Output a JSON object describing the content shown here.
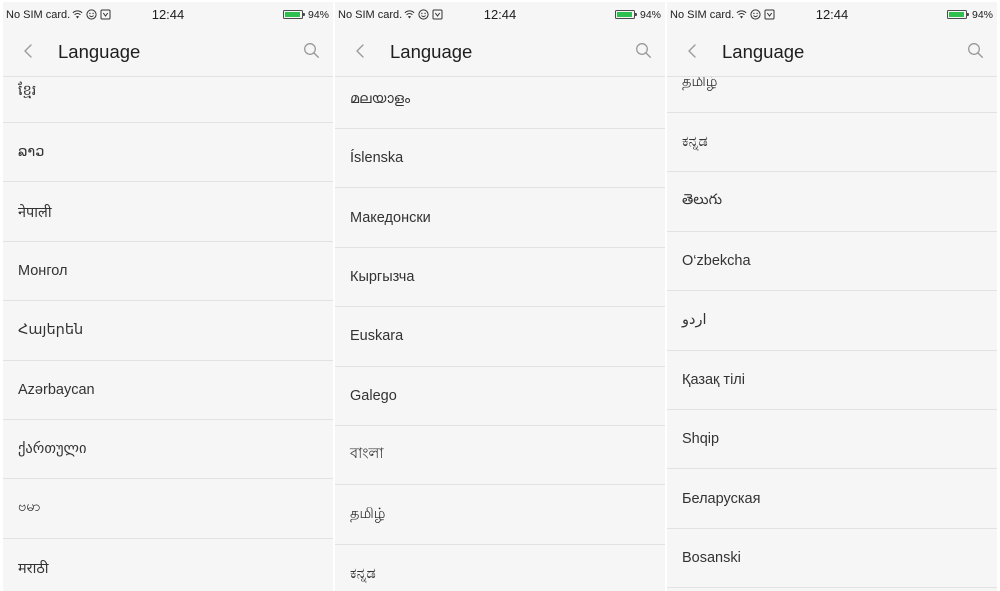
{
  "colors": {
    "page_background": "#ffffff",
    "panel_background": "#f6f6f6",
    "separator": "#e2e2e2",
    "text": "#1e1e1e",
    "list_text": "#333333",
    "icon_gray": "#9a9a9a",
    "battery_green": "#2fbf4f"
  },
  "panels": [
    {
      "status_bar": {
        "carrier": "No SIM card.",
        "icons": [
          "wifi-icon",
          "smiley-icon",
          "notification-icon"
        ],
        "time": "12:44",
        "battery_icon": "battery-icon",
        "battery_level": 0.94,
        "battery_text": "94%"
      },
      "header": {
        "back_icon": "chevron-left-icon",
        "title": "Language",
        "search_icon": "search-icon"
      },
      "languages": [
        "ខ្មែរ",
        "ລາວ",
        "नेपाली",
        "Монгол",
        "Հայերեն",
        "Azərbaycan",
        "ქართული",
        "ဗမာ",
        "मराठी"
      ]
    },
    {
      "status_bar": {
        "carrier": "No SIM card.",
        "icons": [
          "wifi-icon",
          "smiley-icon",
          "notification-icon"
        ],
        "time": "12:44",
        "battery_icon": "battery-icon",
        "battery_level": 0.94,
        "battery_text": "94%"
      },
      "header": {
        "back_icon": "chevron-left-icon",
        "title": "Language",
        "search_icon": "search-icon"
      },
      "languages": [
        "മലയാളം",
        "Íslenska",
        "Македонски",
        "Кыргызча",
        "Euskara",
        "Galego",
        "বাংলা",
        "தமிழ்",
        "ಕನ್ನಡ"
      ]
    },
    {
      "status_bar": {
        "carrier": "No SIM card.",
        "icons": [
          "wifi-icon",
          "smiley-icon",
          "notification-icon"
        ],
        "time": "12:44",
        "battery_icon": "battery-icon",
        "battery_level": 0.94,
        "battery_text": "94%"
      },
      "header": {
        "back_icon": "chevron-left-icon",
        "title": "Language",
        "search_icon": "search-icon"
      },
      "languages": [
        "தமிழ்",
        "ಕನ್ನಡ",
        "తెలుగు",
        "O‘zbekcha",
        "اردو",
        "Қазақ тілі",
        "Shqip",
        "Беларуская",
        "Bosanski"
      ]
    }
  ]
}
